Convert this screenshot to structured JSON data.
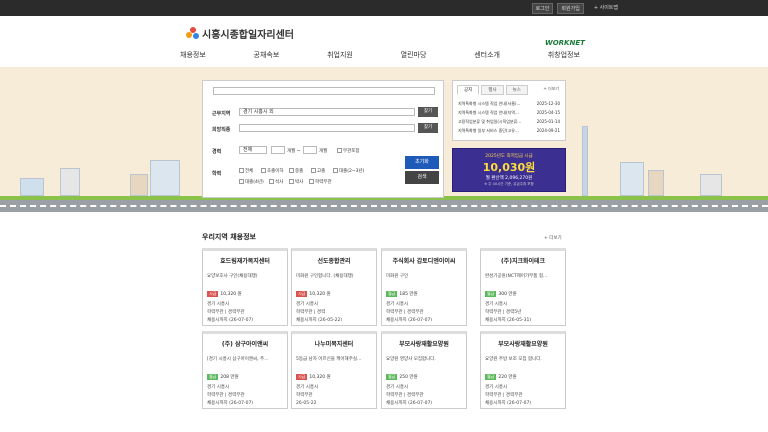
{
  "topbar": {
    "login": "로그인",
    "join": "회원가입",
    "sitemap": "+ 사이트맵"
  },
  "header": {
    "title": "시흥시종합일자리센터",
    "partner": "WORKNET"
  },
  "nav": [
    "채용정보",
    "공채속보",
    "취업지원",
    "열린마당",
    "센터소개",
    "취창업정보"
  ],
  "search": {
    "region_label": "근무지역",
    "region_value": "경기 시흥시 외",
    "region_btn": "찾기",
    "job_label": "희망직종",
    "job_btn": "찾기",
    "career_label": "경력",
    "career_value": "전체",
    "career_month1": "개월 ~",
    "career_month2": "개월",
    "career_none": "무관포함",
    "edu_label": "학력",
    "edu_options": [
      "전체",
      "초졸이하",
      "중졸",
      "고졸",
      "대졸(2~3년)",
      "대졸(4년)",
      "석사",
      "박사",
      "학력무관"
    ],
    "reset_btn": "초기화",
    "search_btn": "검색"
  },
  "notice": {
    "tabs": [
      "공지",
      "행사",
      "뉴스"
    ],
    "more": "+ 더보기",
    "items": [
      {
        "title": "지역특화형 시스템 직업 안내(서울)…",
        "date": "2025-12-30"
      },
      {
        "title": "지역특화형 시스템 직업 안내(지역…",
        "date": "2025-04-15"
      },
      {
        "title": "고용직업분류 및 취업일(시직업분류…",
        "date": "2025-01-14"
      },
      {
        "title": "지역특화형 일부 서비스 중단(고유…",
        "date": "2024-09-21"
      }
    ]
  },
  "banner": {
    "l1": "2025년도 최저임금 시급",
    "l2": "10,030원",
    "l3": "월 환산액 2,096,270원",
    "l4": "※ 주 40시간 기준, 유급주휴 포함"
  },
  "section": {
    "title": "우리지역 채용정보",
    "more": "+ 더보기"
  },
  "cards": [
    {
      "name": "효드림재가복지센터",
      "desc": "요양보호사 구인(채용대행)",
      "pay_type": "시급",
      "pay": "10,320 원",
      "lines": [
        "경기 시흥시",
        "학력무관 | 경력무관",
        "채용시까지 (26-07-07)"
      ]
    },
    {
      "name": "선도종합관리",
      "desc": "미화원 구인합니다. (채용대행)",
      "pay_type": "시급",
      "pay": "10,320 원",
      "lines": [
        "경기 시흥시",
        "학력무관 | 경력",
        "채용시까지 (26-05-22)"
      ]
    },
    {
      "name": "주식회사 갑토디엔이이씨",
      "desc": "미화원 구인",
      "pay_type": "월급",
      "pay": "185 만원",
      "lines": [
        "경기 시흥시",
        "학력무관 | 경력무관",
        "채용시까지 (26-07-07)"
      ]
    },
    {
      "name": "(주)지크화이테크",
      "desc": "완성기공원(NCT제어가부품 협…",
      "pay_type": "월급",
      "pay": "300 만원",
      "lines": [
        "경기 시흥시",
        "학력무관 | 경력5년",
        "채용시까지 (26-05-31)"
      ]
    },
    {
      "name": "(주) 삼구아이앤씨",
      "desc": "[경기 시흥시 삼구아이앤씨, 주…",
      "pay_type": "월급",
      "pay": "208 만원",
      "lines": [
        "경기 시흥시",
        "학력무관 | 경력무관",
        "채용시까지 (26-07-07)"
      ]
    },
    {
      "name": "나누미복지센터",
      "desc": "5등급 남자 어르신을 케어해주실…",
      "pay_type": "시급",
      "pay": "10,320 원",
      "lines": [
        "경기 시흥시",
        "학력무관",
        "26-05-22"
      ]
    },
    {
      "name": "부모사랑재활요양원",
      "desc": "요양원 영양사 모집합니다.",
      "pay_type": "월급",
      "pay": "250 만원",
      "lines": [
        "경기 시흥시",
        "학력무관 | 경력무관",
        "채용시까지 (26-07-07)"
      ]
    },
    {
      "name": "부모사랑재활요양원",
      "desc": "요양원 주방 보조 모집 합니다.",
      "pay_type": "월급",
      "pay": "220 만원",
      "lines": [
        "경기 시흥시",
        "학력무관 | 경력무관",
        "채용시까지 (26-07-07)"
      ]
    }
  ],
  "colors": {
    "pay_hourly": "#d9534f",
    "pay_monthly": "#5cb85c",
    "primary": "#1e5bb8"
  }
}
